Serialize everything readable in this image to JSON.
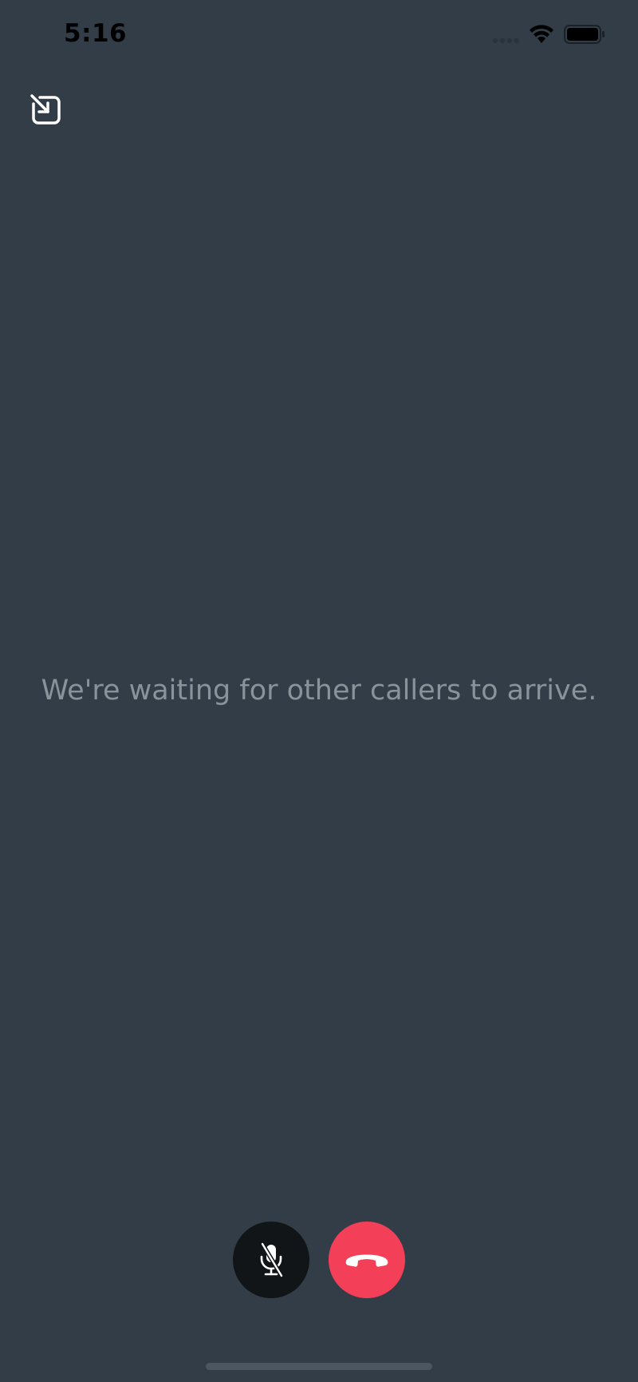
{
  "status_bar": {
    "time": "5:16",
    "icons": [
      "cellular-signal-icon",
      "wifi-icon",
      "battery-icon"
    ]
  },
  "top_actions": {
    "minimize_icon": "minimize-arrow-icon"
  },
  "main": {
    "waiting_message": "We're waiting for other callers to arrive."
  },
  "controls": {
    "mute_icon": "microphone-muted-icon",
    "hangup_icon": "phone-hangup-icon"
  },
  "colors": {
    "background": "#323d47",
    "message_text": "#8a929a",
    "mute_button": "#111518",
    "hangup_button": "#f33f57",
    "home_indicator": "#4d565f"
  }
}
